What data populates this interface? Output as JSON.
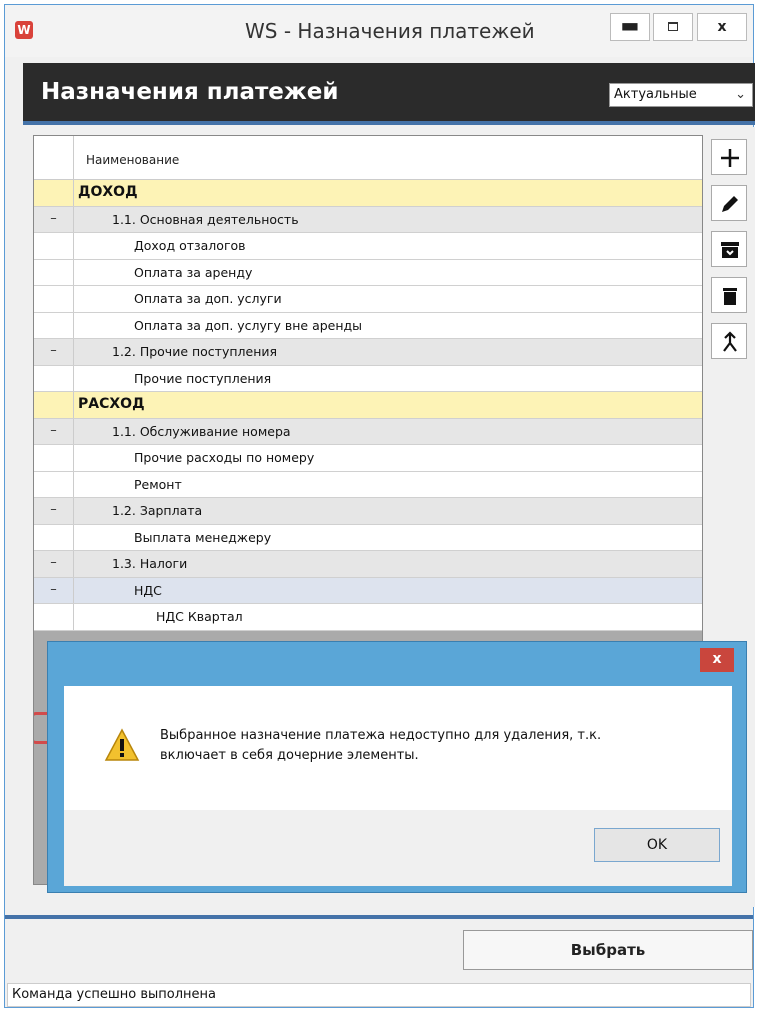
{
  "window": {
    "title": "WS - Назначения платежей",
    "app_icon": "W",
    "min_label": "▬",
    "close_label": "x"
  },
  "header": {
    "title": "Назначения платежей",
    "filter_value": "Актуальные",
    "filter_chevron": "⌄"
  },
  "grid": {
    "column_header": "Наименование",
    "rows": [
      {
        "ctl": "",
        "text": "ДОХОД",
        "type": "cat",
        "level": 0
      },
      {
        "ctl": "–",
        "text": "1.1. Основная деятельность",
        "type": "grp",
        "level": 1
      },
      {
        "ctl": "",
        "text": "Доход отзалогов",
        "type": "item",
        "level": 2
      },
      {
        "ctl": "",
        "text": "Оплата за аренду",
        "type": "item",
        "level": 2
      },
      {
        "ctl": "",
        "text": "Оплата за доп. услуги",
        "type": "item",
        "level": 2
      },
      {
        "ctl": "",
        "text": "Оплата за доп. услугу вне аренды",
        "type": "item",
        "level": 2
      },
      {
        "ctl": "–",
        "text": "1.2. Прочие поступления",
        "type": "grp",
        "level": 1
      },
      {
        "ctl": "",
        "text": "Прочие поступления",
        "type": "item",
        "level": 2
      },
      {
        "ctl": "",
        "text": "РАСХОД",
        "type": "cat",
        "level": 0
      },
      {
        "ctl": "–",
        "text": "1.1. Обслуживание номера",
        "type": "grp",
        "level": 1
      },
      {
        "ctl": "",
        "text": "Прочие расходы по номеру",
        "type": "item",
        "level": 2
      },
      {
        "ctl": "",
        "text": "Ремонт",
        "type": "item",
        "level": 2
      },
      {
        "ctl": "–",
        "text": "1.2. Зарплата",
        "type": "grp",
        "level": 1
      },
      {
        "ctl": "",
        "text": "Выплата менеджеру",
        "type": "item",
        "level": 2
      },
      {
        "ctl": "–",
        "text": "1.3. Налоги",
        "type": "grp",
        "level": 1
      },
      {
        "ctl": "–",
        "text": "НДС",
        "type": "sel",
        "level": 2
      },
      {
        "ctl": "",
        "text": "НДС Квартал",
        "type": "item",
        "level": 3
      }
    ]
  },
  "toolbar": {
    "icons": [
      "plus-icon",
      "pencil-icon",
      "archive-icon",
      "trash-icon",
      "move-icon"
    ]
  },
  "dialog": {
    "close_label": "x",
    "message_line1": "Выбранное назначение платежа недоступно для удаления, т.к.",
    "message_line2": "включает в себя дочерние элементы.",
    "ok_label": "OK"
  },
  "footer": {
    "choose_label": "Выбрать",
    "status": "Команда успешно выполнена"
  },
  "colors": {
    "category_row": "#fdf3b6",
    "group_row": "#e6e6e6",
    "highlight_border": "#d24b4b",
    "dialog_frame": "#5aa6d7",
    "accent": "#4472a8"
  }
}
